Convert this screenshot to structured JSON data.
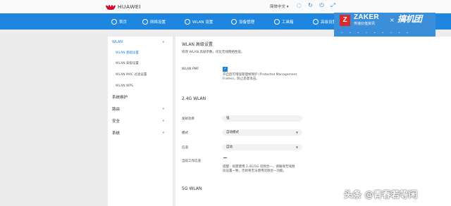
{
  "header": {
    "brand": "HUAWEI",
    "language": "简体中文 ▾",
    "icons": [
      "chat-icon",
      "refresh-icon",
      "logout-icon",
      "expand-icon"
    ]
  },
  "nav": {
    "items": [
      {
        "label": "首页",
        "icon": "home-icon"
      },
      {
        "label": "网络设置",
        "icon": "network-icon"
      },
      {
        "label": "WLAN 设置",
        "icon": "wifi-icon"
      },
      {
        "label": "设备管理",
        "icon": "devices-icon"
      },
      {
        "label": "工具箱",
        "icon": "toolbox-icon"
      },
      {
        "label": "高级设置",
        "icon": "gear-icon"
      }
    ]
  },
  "badge": {
    "letter": "Z",
    "name": "ZAKER",
    "sub": "传递价值资讯",
    "times": "×",
    "partner": "搞机团",
    "dots": "• • • • • • • • •"
  },
  "sidebar": {
    "top": {
      "label": "WLAN",
      "chevron": "▾"
    },
    "subs": [
      {
        "label": "WLAN 基础设置"
      },
      {
        "label": "WLAN 高级设置"
      },
      {
        "label": "WLAN MAC 过滤设置"
      },
      {
        "label": "WLAN WPS"
      }
    ],
    "groups": [
      {
        "label": "系统维护",
        "chevron": ""
      },
      {
        "label": "路由",
        "chevron": "▾"
      },
      {
        "label": "安全",
        "chevron": "▾"
      },
      {
        "label": "系统",
        "chevron": "▾"
      }
    ]
  },
  "main": {
    "title": "WLAN 高级设置",
    "description": "修改 WLAN 高级参数，优化无线网络性能。",
    "pmf_label": "WLAN PMF",
    "pmf_checked": true,
    "pmf_note_1": "开启后可增强管理帧保护 (Protected Management",
    "pmf_note_2": "Frame)，防止恶意攻击。",
    "band_24": "2.4G WLAN",
    "fields": [
      {
        "label": "发射功率",
        "value": "强",
        "dropdown": false
      },
      {
        "label": "模式",
        "value": "自动模式",
        "dropdown": true
      },
      {
        "label": "信道",
        "value": "自动",
        "dropdown": true
      }
    ],
    "channel_label": "当前工作信道",
    "channel_value": "—",
    "channel_note_1": "提醒：如需使用 2.4G/5G 双频合一，请确保无线频",
    "channel_note_2": "段设置一致，否则将无法使用双频合一功能。",
    "band_5": "5G WLAN"
  },
  "watermark": "头条 @青春若等闲",
  "colors": {
    "nav": "#1e86de",
    "accent": "#1e7fd6",
    "brand_red": "#cf0a2c"
  }
}
